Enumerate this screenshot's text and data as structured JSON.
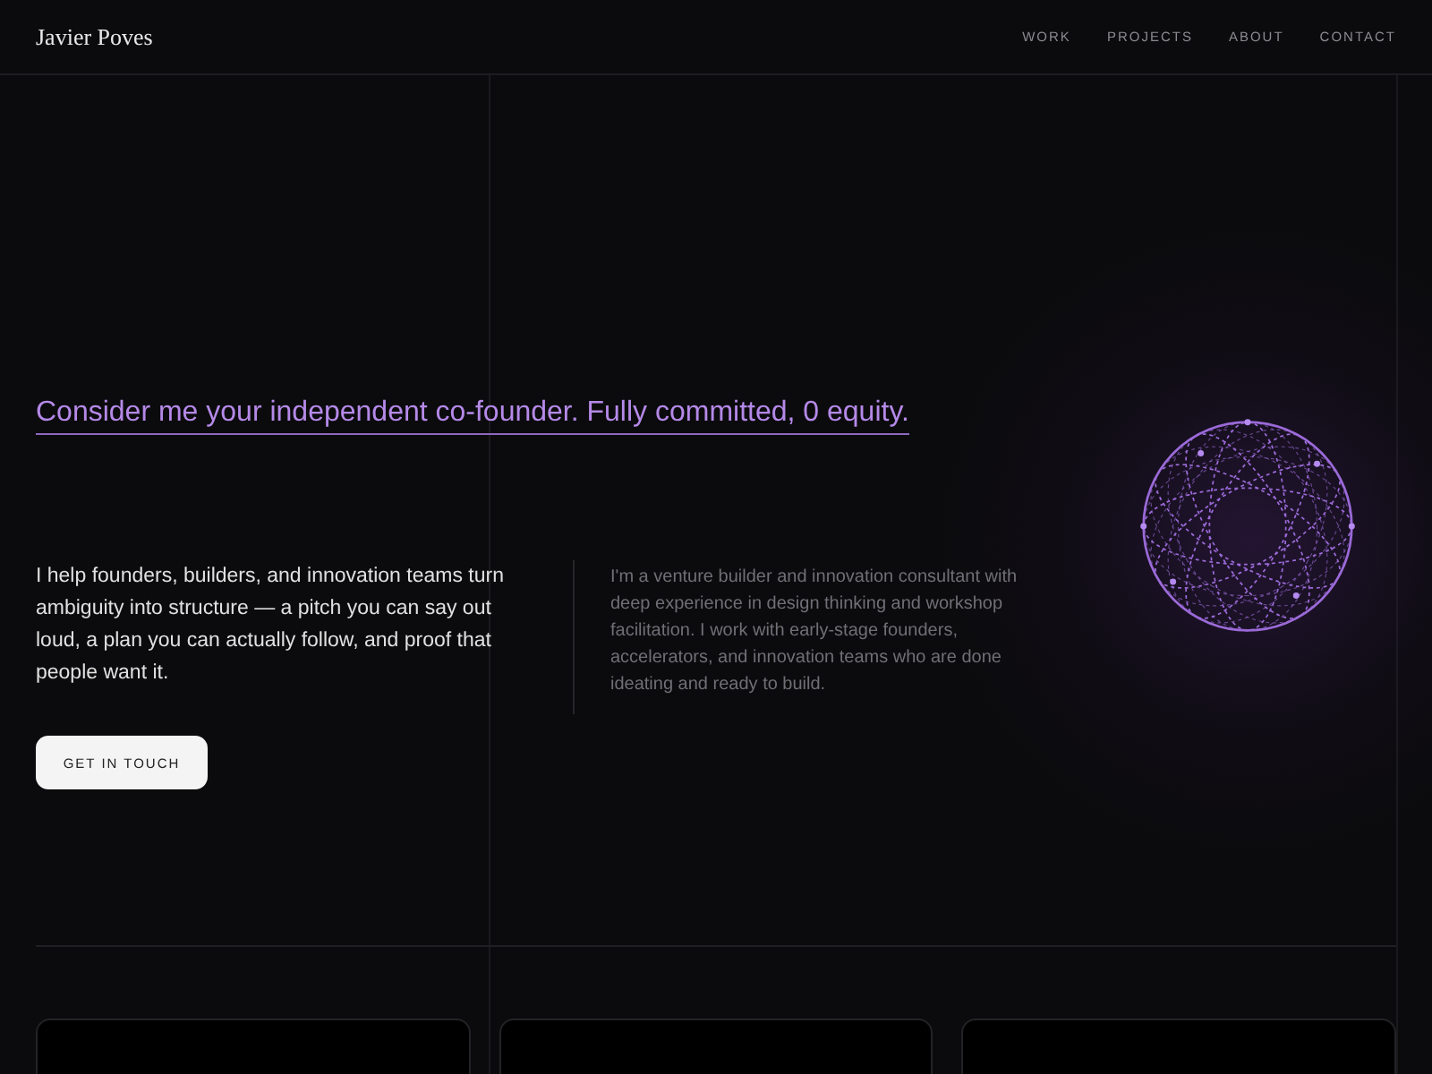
{
  "header": {
    "brand": "Javier Poves",
    "nav": [
      "WORK",
      "PROJECTS",
      "ABOUT",
      "CONTACT"
    ]
  },
  "hero": {
    "tagline": "Consider me your independent co-founder. Fully committed, 0 equity.",
    "intro": "I help founders, builders, and innovation teams turn ambiguity into structure — a pitch you can say out loud, a plan you can actually follow, and proof that people want it.",
    "cta": "GET IN TOUCH",
    "bio": "I'm a venture builder and innovation consultant with deep experience in design thinking and workshop facilitation. I work with early-stage founders, accelerators, and innovation teams who are done ideating and ready to build."
  }
}
